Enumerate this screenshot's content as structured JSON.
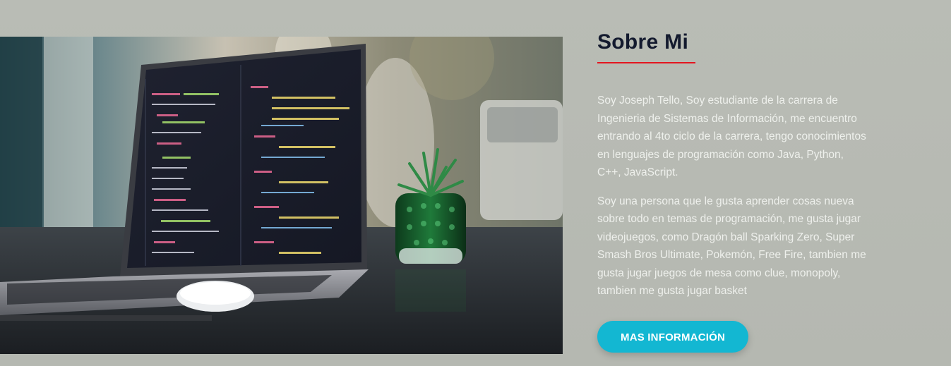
{
  "about": {
    "title": "Sobre Mi",
    "paragraph_1": "Soy Joseph Tello, Soy estudiante de la carrera de Ingenieria de Sistemas de Información, me encuentro entrando al 4to ciclo de la carrera, tengo conocimientos en lenguajes de programación como Java, Python, C++, JavaScript.",
    "paragraph_2": "Soy una persona que le gusta aprender cosas nueva sobre todo en temas de programación, me gusta jugar videojuegos, como Dragón ball Sparking Zero, Super Smash Bros Ultimate, Pokemón, Free Fire, tambien me gusta jugar juegos de mesa como clue, monopoly, tambien me gusta jugar basket",
    "button_label": "MAS INFORMACIÓN"
  },
  "colors": {
    "background": "#b7bab3",
    "title": "#131a2e",
    "title_underline": "#e4151f",
    "text": "#eef0ec",
    "button": "#13b7d2"
  }
}
